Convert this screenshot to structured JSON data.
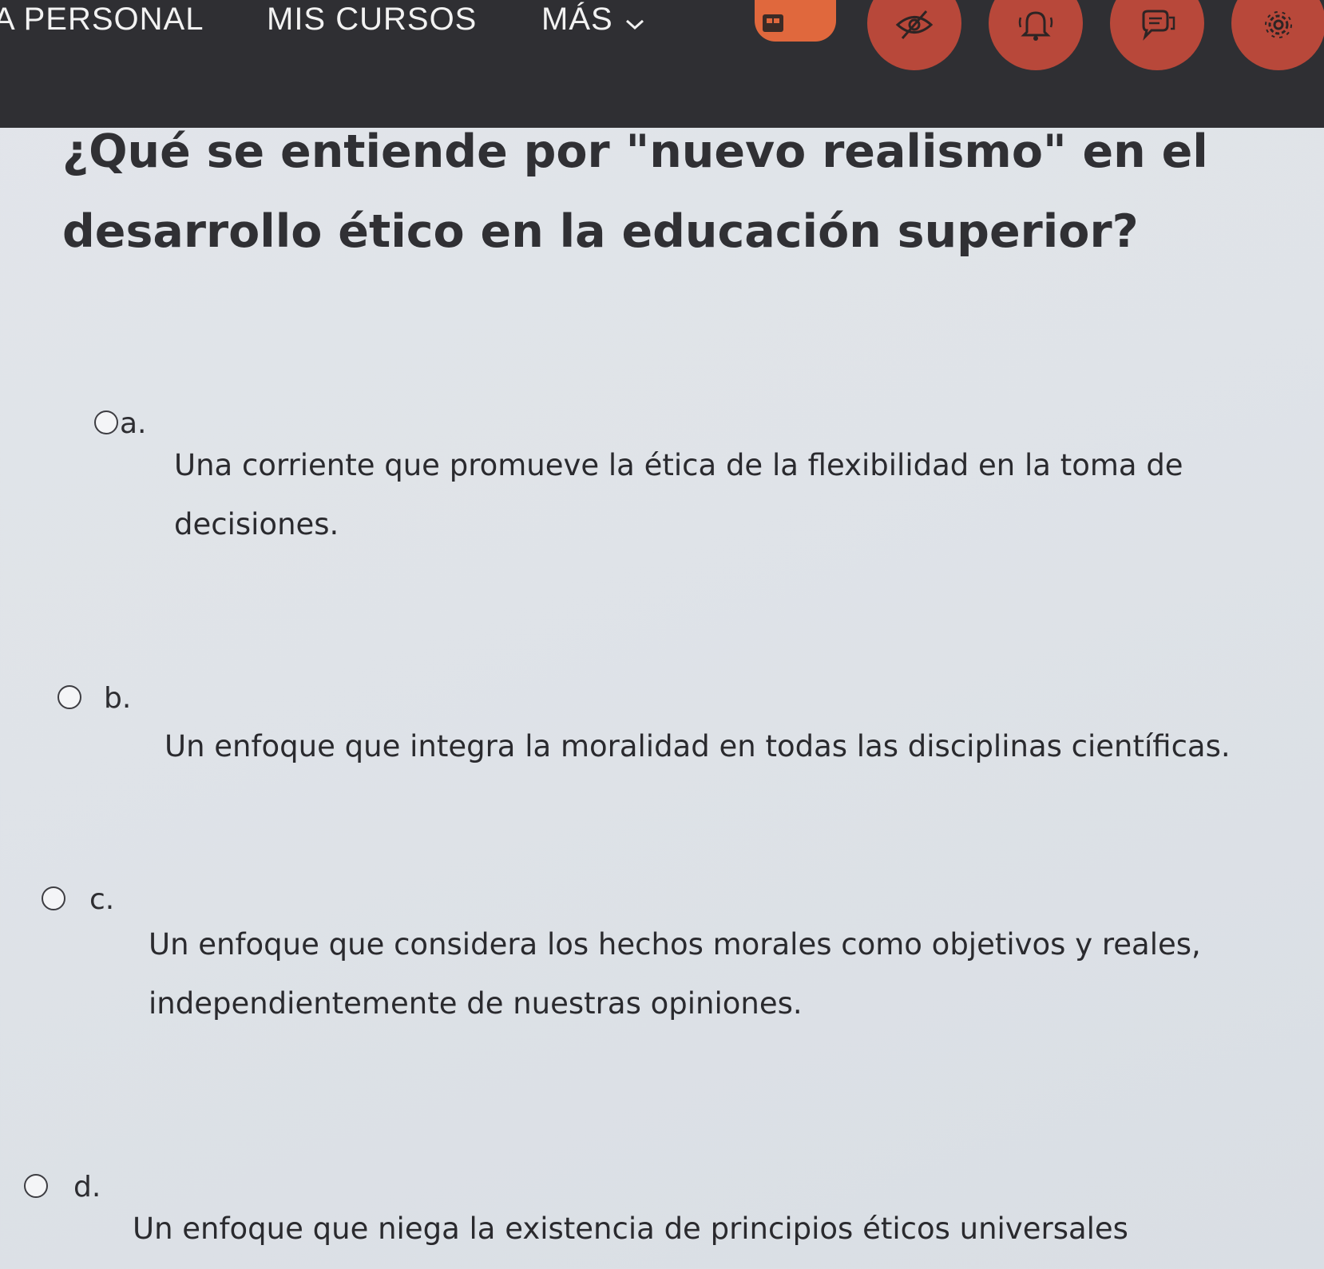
{
  "nav": {
    "items": [
      {
        "label": "A PERSONAL"
      },
      {
        "label": "MIS CURSOS"
      },
      {
        "label": "MÁS"
      }
    ],
    "icons": [
      "visibility-toggle-icon",
      "eye-slash-icon",
      "bell-icon",
      "chat-icon",
      "gear-icon"
    ]
  },
  "question": {
    "text": "¿Qué se entiende por \"nuevo realismo\" en el desarrollo ético en la educación superior?"
  },
  "options": [
    {
      "letter": "a.",
      "text": "Una corriente que promueve la ética de la flexibilidad en la toma de decisiones."
    },
    {
      "letter": "b.",
      "text": "Un enfoque que integra la moralidad en todas las disciplinas científicas."
    },
    {
      "letter": "c.",
      "text": "Un enfoque que considera los hechos morales como objetivos y reales, independientemente de nuestras opiniones."
    },
    {
      "letter": "d.",
      "text": "Un enfoque que niega la existencia de principios éticos universales"
    }
  ],
  "colors": {
    "topbar": "#2f2f33",
    "accent_orange": "#e0683d",
    "accent_red": "#b8483a"
  }
}
